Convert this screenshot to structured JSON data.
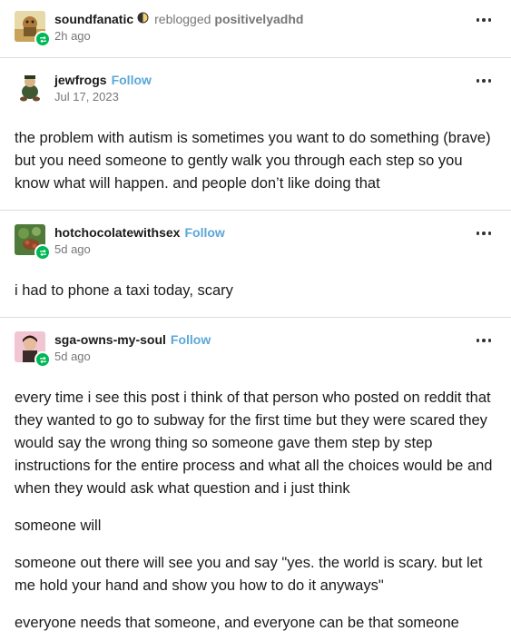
{
  "top": {
    "username": "soundfanatic",
    "action": "reblogged",
    "reblogged_from": "positivelyadhd",
    "time": "2h ago"
  },
  "posts": [
    {
      "username": "jewfrogs",
      "follow": "Follow",
      "date": "Jul 17, 2023",
      "paragraphs": [
        "the problem with autism is sometimes you want to do something (brave) but you need someone to gently walk you through each step so you know what will happen. and people don’t like doing that"
      ]
    },
    {
      "username": "hotchocolatewithsex",
      "follow": "Follow",
      "date": "5d ago",
      "paragraphs": [
        "i had to phone a taxi today, scary"
      ]
    },
    {
      "username": "sga-owns-my-soul",
      "follow": "Follow",
      "date": "5d ago",
      "paragraphs": [
        "every time i see this post i think of that person who posted on reddit that they wanted to go to subway for the first time but they were scared they would say the wrong thing so someone gave them step by step instructions for the entire process and what all the choices would be and when they would ask what question and i just think",
        "someone will",
        "someone out there will see you and say \"yes. the world is scary. but let me hold your hand and show you how to do it anyways\"",
        "everyone needs that someone, and everyone can be that someone"
      ]
    }
  ],
  "icons": {
    "more": "more-options-icon",
    "reblog": "reblog-icon",
    "badge": "half-moon-badge-icon"
  },
  "colors": {
    "follow": "#5aa7d8",
    "reblog_badge": "#00b856",
    "meta_text": "#777777",
    "divider": "#dcdcdc"
  }
}
